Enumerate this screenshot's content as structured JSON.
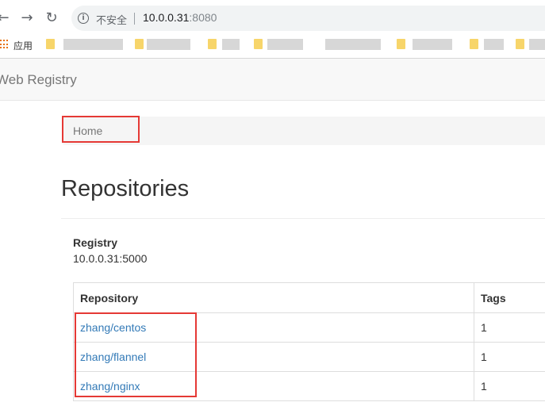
{
  "browser": {
    "back_glyph": "←",
    "forward_glyph": "→",
    "reload_glyph": "↻",
    "info_glyph": "i",
    "security_text": "不安全",
    "url_host": "10.0.0.31",
    "url_port": ":8080"
  },
  "bookmarks": {
    "apps_label": "应用"
  },
  "navbar": {
    "brand": "Web Registry"
  },
  "breadcrumb": {
    "home": "Home"
  },
  "main": {
    "title": "Repositories",
    "registry_label": "Registry",
    "registry_value": "10.0.0.31:5000"
  },
  "table": {
    "headers": [
      "Repository",
      "Tags"
    ],
    "rows": [
      {
        "repository": "zhang/centos",
        "tags": "1"
      },
      {
        "repository": "zhang/flannel",
        "tags": "1"
      },
      {
        "repository": "zhang/nginx",
        "tags": "1"
      }
    ]
  },
  "colors": {
    "link": "#337ab7",
    "highlight_box": "#e53935"
  }
}
